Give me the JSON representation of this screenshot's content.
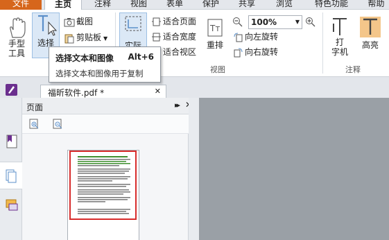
{
  "menu": {
    "tabs": [
      "文件",
      "主页",
      "注释",
      "视图",
      "表单",
      "保护",
      "共享",
      "浏览",
      "特色功能",
      "帮助"
    ],
    "active": "主页"
  },
  "ribbon": {
    "hand_tool": "手型\n工具",
    "hand_tool_l1": "手型",
    "hand_tool_l2": "工具",
    "select": "选择",
    "screenshot": "截图",
    "clipboard": "剪贴板",
    "actual_size": "实际",
    "fit_page": "适合页面",
    "fit_width": "适合宽度",
    "fit_visible": "适合视区",
    "reflow": "重排",
    "zoom_value": "100%",
    "rotate_left": "向左旋转",
    "rotate_right": "向右旋转",
    "view_group": "视图",
    "typewriter_l1": "打",
    "typewriter_l2": "字机",
    "highlight": "高亮",
    "comment_group": "注释"
  },
  "tooltip": {
    "title": "选择文本和图像",
    "shortcut": "Alt+6",
    "description": "选择文本和图像用于复制"
  },
  "document": {
    "tab_label": "福昕软件.pdf *",
    "close_glyph": "✕"
  },
  "panel": {
    "title": "页面",
    "collapse_glyph": "▸▸"
  },
  "colors": {
    "file_tab": "#d6661c",
    "selection_red": "#d72b2b",
    "thumb_green": "#3f8f2f"
  }
}
